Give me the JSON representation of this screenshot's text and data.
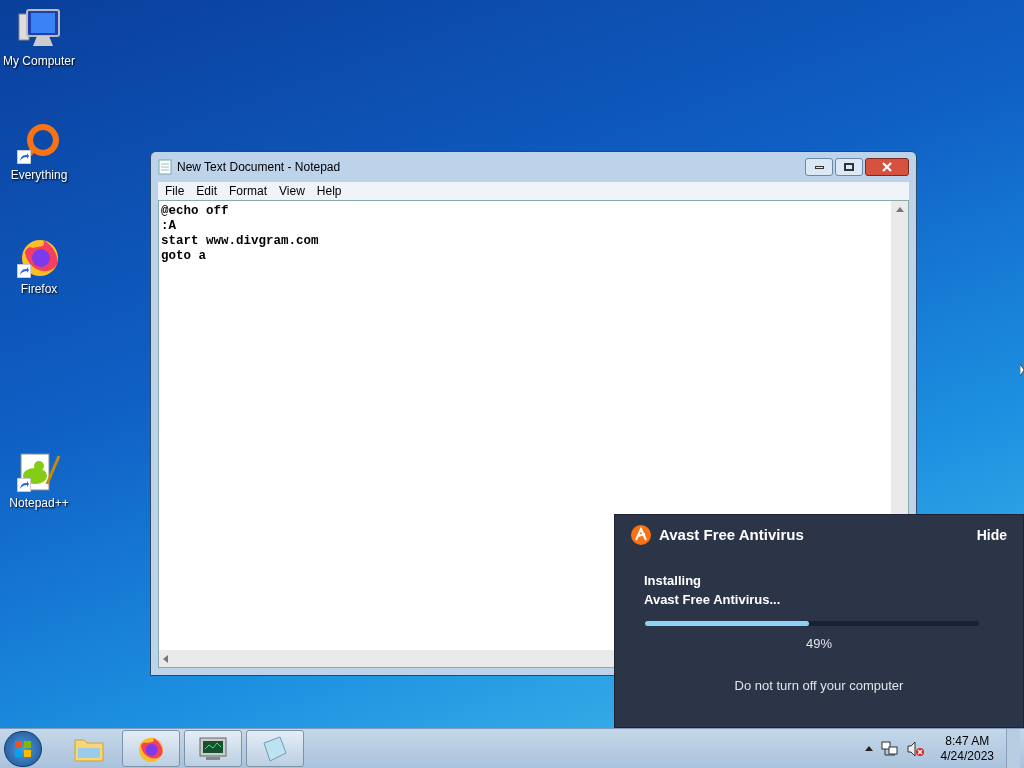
{
  "desktop_icons": [
    {
      "label": "My Computer",
      "kind": "computer"
    },
    {
      "label": "Everything",
      "kind": "everything"
    },
    {
      "label": "Firefox",
      "kind": "firefox"
    },
    {
      "label": "Notepad++",
      "kind": "notepadpp"
    }
  ],
  "notepad": {
    "title": "New Text Document - Notepad",
    "menu": [
      "File",
      "Edit",
      "Format",
      "View",
      "Help"
    ],
    "lines": [
      "@echo off",
      ":A",
      "start www.divgram.com",
      "goto a"
    ]
  },
  "avast": {
    "title": "Avast Free Antivirus",
    "hide": "Hide",
    "status_lines": [
      "Installing",
      "Avast Free Antivirus..."
    ],
    "level": 0.49,
    "percent": "49%",
    "note": "Do not turn off your computer"
  },
  "taskbar": {
    "items": [
      {
        "kind": "explorer",
        "running": false
      },
      {
        "kind": "firefox",
        "running": true
      },
      {
        "kind": "monitor",
        "running": true
      },
      {
        "kind": "notepad",
        "running": true
      }
    ],
    "time": "8:47 AM",
    "date": "4/24/2023"
  }
}
